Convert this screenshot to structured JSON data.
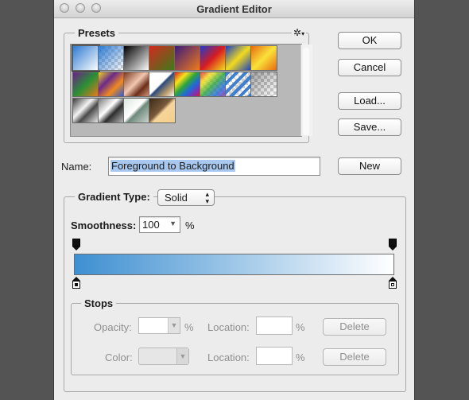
{
  "window": {
    "title": "Gradient Editor"
  },
  "presets": {
    "label": "Presets",
    "swatches": [
      {
        "name": "Foreground to Background",
        "bg": "linear-gradient(135deg,#2f7bd1,#ffffff)"
      },
      {
        "name": "Foreground to Transparent",
        "bg": "linear-gradient(135deg,rgba(47,123,209,1),rgba(47,123,209,0)),repeating-conic-gradient(#cfcfcf 0 25%,#fff 0 50%) 0 0/8px 8px"
      },
      {
        "name": "Black, White",
        "bg": "linear-gradient(135deg,#000,#fff)"
      },
      {
        "name": "Red, Green",
        "bg": "linear-gradient(135deg,#d12a1f,#3c7c1a)"
      },
      {
        "name": "Violet, Orange",
        "bg": "linear-gradient(135deg,#3a1d7a,#f37a1a)"
      },
      {
        "name": "Blue, Red, Yellow",
        "bg": "linear-gradient(135deg,#1e3cc8,#d81c20 50%,#f3e21a)"
      },
      {
        "name": "Blue, Yellow, Blue",
        "bg": "linear-gradient(135deg,#1a3fc0,#f2da1f 50%,#1a3fc0)"
      },
      {
        "name": "Orange, Yellow, Orange",
        "bg": "linear-gradient(135deg,#e86b12,#f9e23a 50%,#e86b12)"
      },
      {
        "name": "Violet, Green, Orange",
        "bg": "linear-gradient(135deg,#6b1f86,#2a8f36 50%,#ed7a19)"
      },
      {
        "name": "Yellow, Violet, Orange, Blue",
        "bg": "linear-gradient(135deg,#f0d12a,#6b2a8a 35%,#f08a1f 65%,#2a5ad8)"
      },
      {
        "name": "Copper",
        "bg": "linear-gradient(135deg,#7a3a24,#f2c7b0 45%,#6a2e1a 70%,#d99a7a)"
      },
      {
        "name": "Chrome",
        "bg": "linear-gradient(135deg,#fff 0,#fff 45%,#2a4a7a 50%,#b89a6a 75%,#fff)"
      },
      {
        "name": "Spectrum",
        "bg": "linear-gradient(135deg,#d8201f,#f7e31b 25%,#2fa63a 45%,#1f6ad8 65%,#8a2aa8 85%,#d8201f)"
      },
      {
        "name": "Transparent Rainbow",
        "bg": "linear-gradient(135deg,rgba(216,32,31,.8),rgba(247,227,27,.8) 25%,rgba(47,166,58,.8) 50%,rgba(31,106,216,.8) 75%,rgba(138,42,168,.8)),repeating-conic-gradient(#cfcfcf 0 25%,#fff 0 50%) 0 0/8px 8px"
      },
      {
        "name": "Transparent Stripes",
        "bg": "repeating-linear-gradient(135deg,#3e7fd0 0 4px,rgba(255,255,255,0) 4px 8px),repeating-conic-gradient(#cfcfcf 0 25%,#fff 0 50%) 0 0/8px 8px"
      },
      {
        "name": "Neutral Density",
        "bg": "linear-gradient(135deg,rgba(0,0,0,.35),rgba(0,0,0,0)),repeating-conic-gradient(#cfcfcf 0 25%,#fff 0 50%) 0 0/8px 8px"
      },
      {
        "name": "Silver",
        "bg": "linear-gradient(135deg,#3a3a3a,#f4f4f4 40%,#4a4a4a 60%,#ededed)"
      },
      {
        "name": "Steel",
        "bg": "linear-gradient(135deg,#7a7a7a,#ffffff 40%,#2e2e2e 60%,#bcbcbc)"
      },
      {
        "name": "Green Chrome",
        "bg": "linear-gradient(135deg,#dde6e0,#ffffff 45%,#6f8a7c 55%,#d0d6d3)"
      },
      {
        "name": "Gold",
        "bg": "linear-gradient(135deg,#3a2a1a,#7a5a3a 45%,#f7d59a 55%,#f4cf8a)"
      }
    ]
  },
  "buttons": {
    "ok": "OK",
    "cancel": "Cancel",
    "load": "Load...",
    "save": "Save...",
    "new": "New"
  },
  "name_field": {
    "label": "Name:",
    "value": "Foreground to Background"
  },
  "gradient_type": {
    "label": "Gradient Type:",
    "value": "Solid"
  },
  "smoothness": {
    "label": "Smoothness:",
    "value": "100",
    "unit": "%"
  },
  "gradient_bar": {
    "start_color": "#3e8fd1",
    "end_color": "#ffffff"
  },
  "stops": {
    "label": "Stops",
    "opacity_label": "Opacity:",
    "opacity_unit": "%",
    "color_label": "Color:",
    "location_label": "Location:",
    "location_unit": "%",
    "delete_label": "Delete"
  },
  "colors": {
    "selection": "#a8c8ef"
  }
}
